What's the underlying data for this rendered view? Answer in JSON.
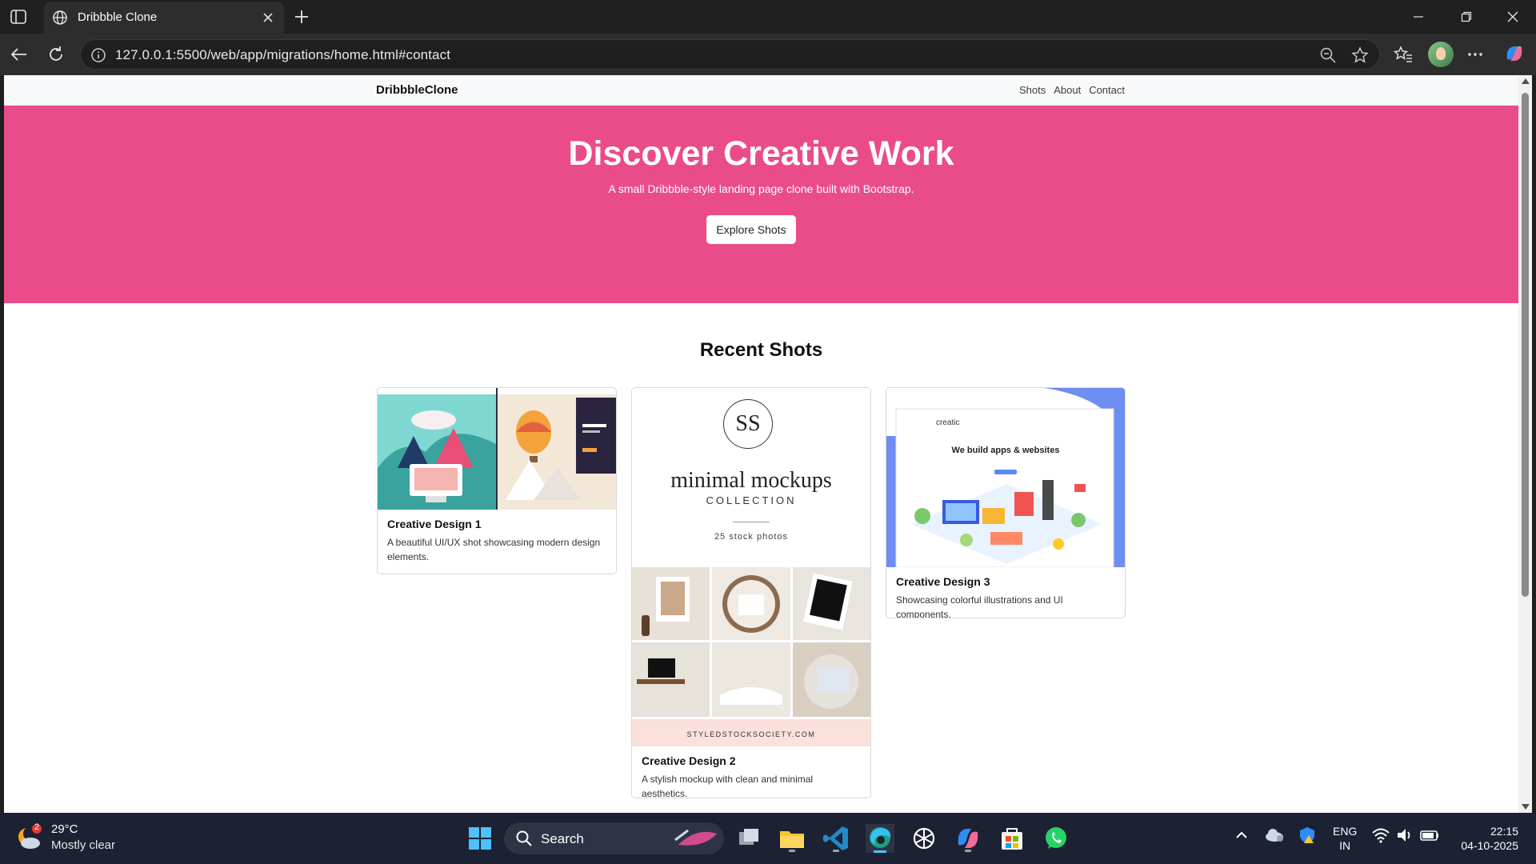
{
  "browser": {
    "tab_title": "Dribbble Clone",
    "url": "127.0.0.1:5500/web/app/migrations/home.html#contact"
  },
  "site": {
    "brand": "DribbbleClone",
    "nav": [
      "Shots",
      "About",
      "Contact"
    ],
    "hero": {
      "title": "Discover Creative Work",
      "subtitle": "A small Dribbble-style landing page clone built with Bootstrap.",
      "button": "Explore Shots",
      "bg_color": "#ea4c89"
    },
    "section_title": "Recent Shots",
    "cards": [
      {
        "title": "Creative Design 1",
        "text": "A beautiful UI/UX shot showcasing modern design elements."
      },
      {
        "title": "Creative Design 2",
        "text": "A stylish mockup with clean and minimal aesthetics.",
        "image": {
          "monogram": "SS",
          "heading": "minimal mockups",
          "sub": "COLLECTION",
          "count": "25 stock photos",
          "footer": "STYLEDSTOCKSOCIETY.COM"
        }
      },
      {
        "title": "Creative Design 3",
        "text": "Showcasing colorful illustrations and UI components.",
        "image": {
          "logo": "creatic",
          "headline": "We build apps & websites"
        }
      }
    ]
  },
  "taskbar": {
    "weather_badge": "2",
    "temperature": "29°C",
    "weather": "Mostly clear",
    "search": "Search",
    "lang_top": "ENG",
    "lang_bottom": "IN",
    "time": "22:15",
    "date": "04-10-2025"
  }
}
